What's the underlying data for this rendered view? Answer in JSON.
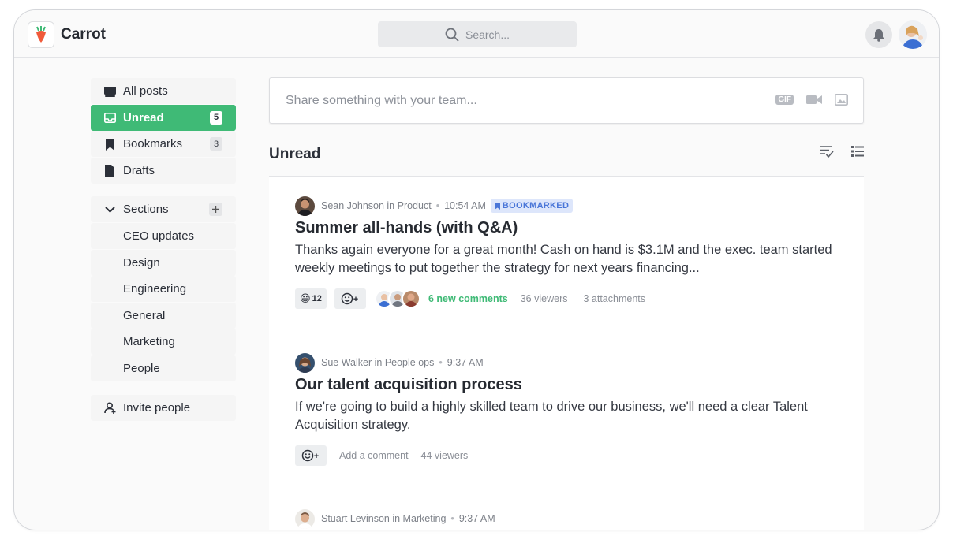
{
  "app": {
    "name": "Carrot"
  },
  "search": {
    "placeholder": "Search..."
  },
  "sidebar": {
    "items": [
      {
        "label": "All posts",
        "icon": "posts-icon"
      },
      {
        "label": "Unread",
        "icon": "inbox-icon",
        "count": "5",
        "active": true
      },
      {
        "label": "Bookmarks",
        "icon": "bookmark-icon",
        "count": "3"
      },
      {
        "label": "Drafts",
        "icon": "draft-icon"
      }
    ],
    "sections_label": "Sections",
    "sections": [
      "CEO updates",
      "Design",
      "Engineering",
      "General",
      "Marketing",
      "People"
    ],
    "invite_label": "Invite people"
  },
  "composer": {
    "placeholder": "Share something with your team...",
    "gif_label": "GIF"
  },
  "feed": {
    "title": "Unread",
    "posts": [
      {
        "author": "Sean Johnson in Product",
        "time": "10:54 AM",
        "badge": "BOOKMARKED",
        "title": "Summer all-hands (with Q&A)",
        "body": "Thanks again everyone for a great month! Cash on hand is $3.1M and the exec. team started weekly meetings to put together the strategy for next years financing...",
        "reaction_emoji": "😀",
        "reaction_count": "12",
        "comments": "6 new comments",
        "viewers": "36 viewers",
        "attachments": "3 attachments"
      },
      {
        "author": "Sue Walker in People ops",
        "time": "9:37 AM",
        "title": "Our talent acquisition process",
        "body": "If we're going to build a highly skilled team to drive our business, we'll need a clear Talent Acquisition strategy.",
        "comment_prompt": "Add a comment",
        "viewers": "44 viewers"
      },
      {
        "author": "Stuart Levinson in Marketing",
        "time": "9:37 AM"
      }
    ]
  },
  "colors": {
    "accent": "#3fba76",
    "badge_bg": "#dde6fb",
    "badge_text": "#4a76d8"
  }
}
